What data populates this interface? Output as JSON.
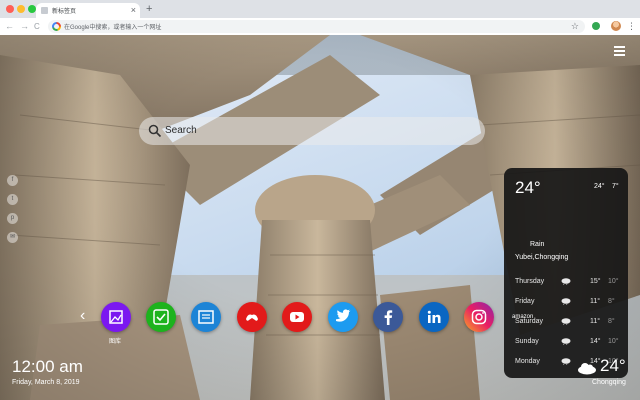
{
  "browser": {
    "tab_title": "新标签页",
    "tab_close": "×",
    "new_tab": "+",
    "omnibox_placeholder": "在Google中搜索，或者输入一个网址",
    "nav": {
      "back": "←",
      "forward": "→",
      "reload": "C"
    },
    "star": "☆",
    "menu": "⋮"
  },
  "page": {
    "search_placeholder": "Search",
    "side_icons": [
      "f",
      "t",
      "p",
      "✉"
    ],
    "weather_card": {
      "temp": "24°",
      "high": "24°",
      "low": "7°",
      "condition": "Rain",
      "location": "Yubei,Chongqing",
      "forecast": [
        {
          "day": "Thursday",
          "high": "15°",
          "low": "10°"
        },
        {
          "day": "Friday",
          "high": "11°",
          "low": "8°"
        },
        {
          "day": "Saturday",
          "high": "11°",
          "low": "8°"
        },
        {
          "day": "Sunday",
          "high": "14°",
          "low": "10°"
        },
        {
          "day": "Monday",
          "high": "14°",
          "low": "10°"
        }
      ]
    },
    "dock": {
      "prev_arrow": "‹",
      "apps": [
        {
          "name": "图库",
          "icon": "gallery-icon",
          "color": "#7b18f0"
        },
        {
          "name": "",
          "icon": "check-icon",
          "color": "#1db31d"
        },
        {
          "name": "",
          "icon": "news-icon",
          "color": "#1d84d6"
        },
        {
          "name": "",
          "icon": "game-icon",
          "color": "#e21a1a"
        },
        {
          "name": "",
          "icon": "youtube-icon",
          "color": "#e21a1a"
        },
        {
          "name": "",
          "icon": "twitter-icon",
          "color": "#1d9bf0"
        },
        {
          "name": "",
          "icon": "facebook-icon",
          "color": "#3b5998"
        },
        {
          "name": "",
          "icon": "linkedin-icon",
          "color": "#0a66c2"
        },
        {
          "name": "",
          "icon": "instagram-icon",
          "color": "#d6249f"
        }
      ],
      "partial_label": "amazon"
    },
    "clock": {
      "time": "12:00 am",
      "date": "Friday, March 8, 2019"
    },
    "bottom_weather": {
      "temp": "24°",
      "city": "Chongqing"
    }
  }
}
